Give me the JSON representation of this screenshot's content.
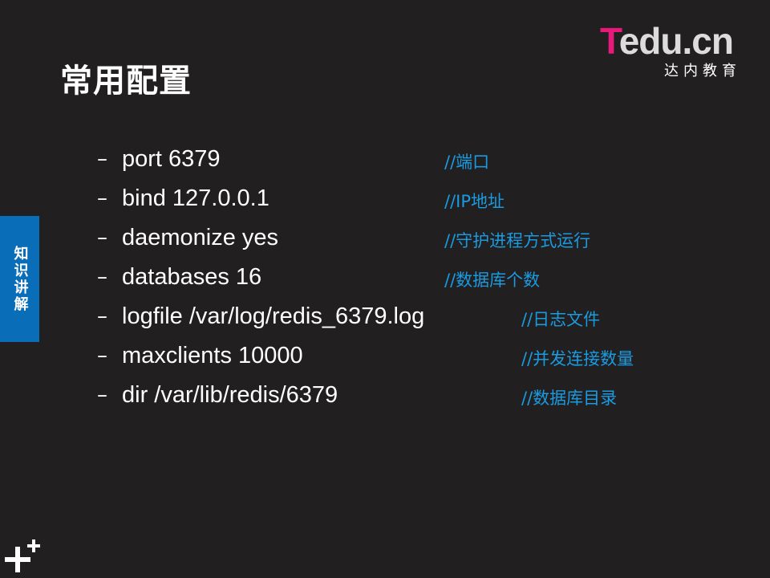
{
  "slide": {
    "title": "常用配置",
    "logo": {
      "mark_first": "T",
      "mark_rest": "edu.cn",
      "subtitle": "达内教育"
    },
    "side_tab": {
      "label": "知识讲解"
    },
    "items": [
      {
        "bullet": "–",
        "command": "port 6379",
        "comment": "//端口"
      },
      {
        "bullet": "–",
        "command": "bind 127.0.0.1",
        "comment": "//IP地址"
      },
      {
        "bullet": "–",
        "command": "daemonize yes",
        "comment": "//守护进程方式运行"
      },
      {
        "bullet": "–",
        "command": "databases 16",
        "comment": "//数据库个数"
      },
      {
        "bullet": "–",
        "command": "logfile /var/log/redis_6379.log",
        "comment": "//日志文件"
      },
      {
        "bullet": "–",
        "command": "maxclients 10000",
        "comment": "//并发连接数量"
      },
      {
        "bullet": "–",
        "command": "dir /var/lib/redis/6379",
        "comment": "//数据库目录"
      }
    ],
    "colors": {
      "background": "#221f20",
      "text": "#ffffff",
      "comment": "#1a9be0",
      "side_tab": "#0a6db8",
      "logo_accent": "#e8197a"
    },
    "corner_icon": "plus-plus-icon"
  }
}
